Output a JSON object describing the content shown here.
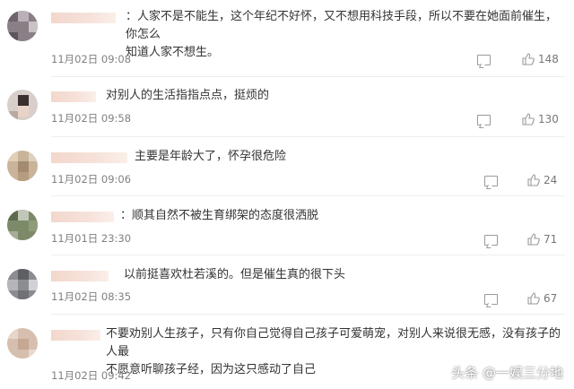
{
  "comments": [
    {
      "text": "：人家不是不能生，这个年纪不好怀，又不想用科技手段，所以不要在她面前催生，你怎么\n知道人家不想生。",
      "time": "11月02日  09:08",
      "likes": "148"
    },
    {
      "text": "对别人的生活指指点点，挺烦的",
      "time": "11月02日  09:58",
      "likes": "130"
    },
    {
      "text": "主要是年龄大了，怀孕很危险",
      "time": "11月02日  09:06",
      "likes": "24"
    },
    {
      "text": "：顺其自然不被生育绑架的态度很洒脱",
      "time": "11月01日  23:30",
      "likes": "71"
    },
    {
      "text": "以前挺喜欢杜若溪的。但是催生真的很下头",
      "time": "11月02日  08:35",
      "likes": "67"
    },
    {
      "text": "不要劝别人生孩子，只有你自己觉得自己孩子可爱萌宠，对别人来说很无感，没有孩子的人最\n不愿意听聊孩子经，因为这只感动了自己",
      "time": "11月02日  09:42",
      "likes": ""
    }
  ],
  "watermark": "头条 @一娱三分地",
  "colors": {
    "text": "#333333",
    "meta": "#808080",
    "icon": "#9a9a9a"
  }
}
